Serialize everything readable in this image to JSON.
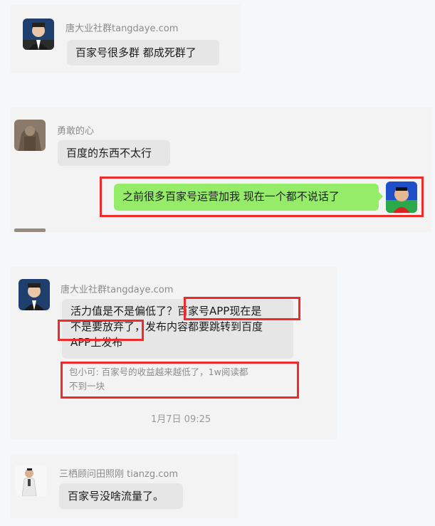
{
  "messages": [
    {
      "sender": "唐大业社群tangdaye.com",
      "text": "百家号很多群 都成死群了"
    },
    {
      "sender": "勇敢的心",
      "text": "百度的东西不太行"
    },
    {
      "sender": "",
      "text": "之前很多百家号运营加我 现在一个都不说话了"
    },
    {
      "sender": "唐大业社群tangdaye.com",
      "text_line1": "活力值是不是偏低了？百家号APP现在是",
      "text_line2": "不是要放弃了，发布内容都要跳转到百度",
      "text_line3": "APP上发布",
      "quote_line1": "包小可: 百家号的收益越来越低了，1w阅读都",
      "quote_line2": "不到一块",
      "timestamp": "1月7日 09:25"
    },
    {
      "sender": "三栖顾问田照刚 tianzg.com",
      "text": "百家号没啥流量了。"
    }
  ],
  "colors": {
    "highlight_border": "#ee2b2b",
    "sent_bubble": "#95ec69",
    "received_bubble": "#e6e6e6"
  }
}
